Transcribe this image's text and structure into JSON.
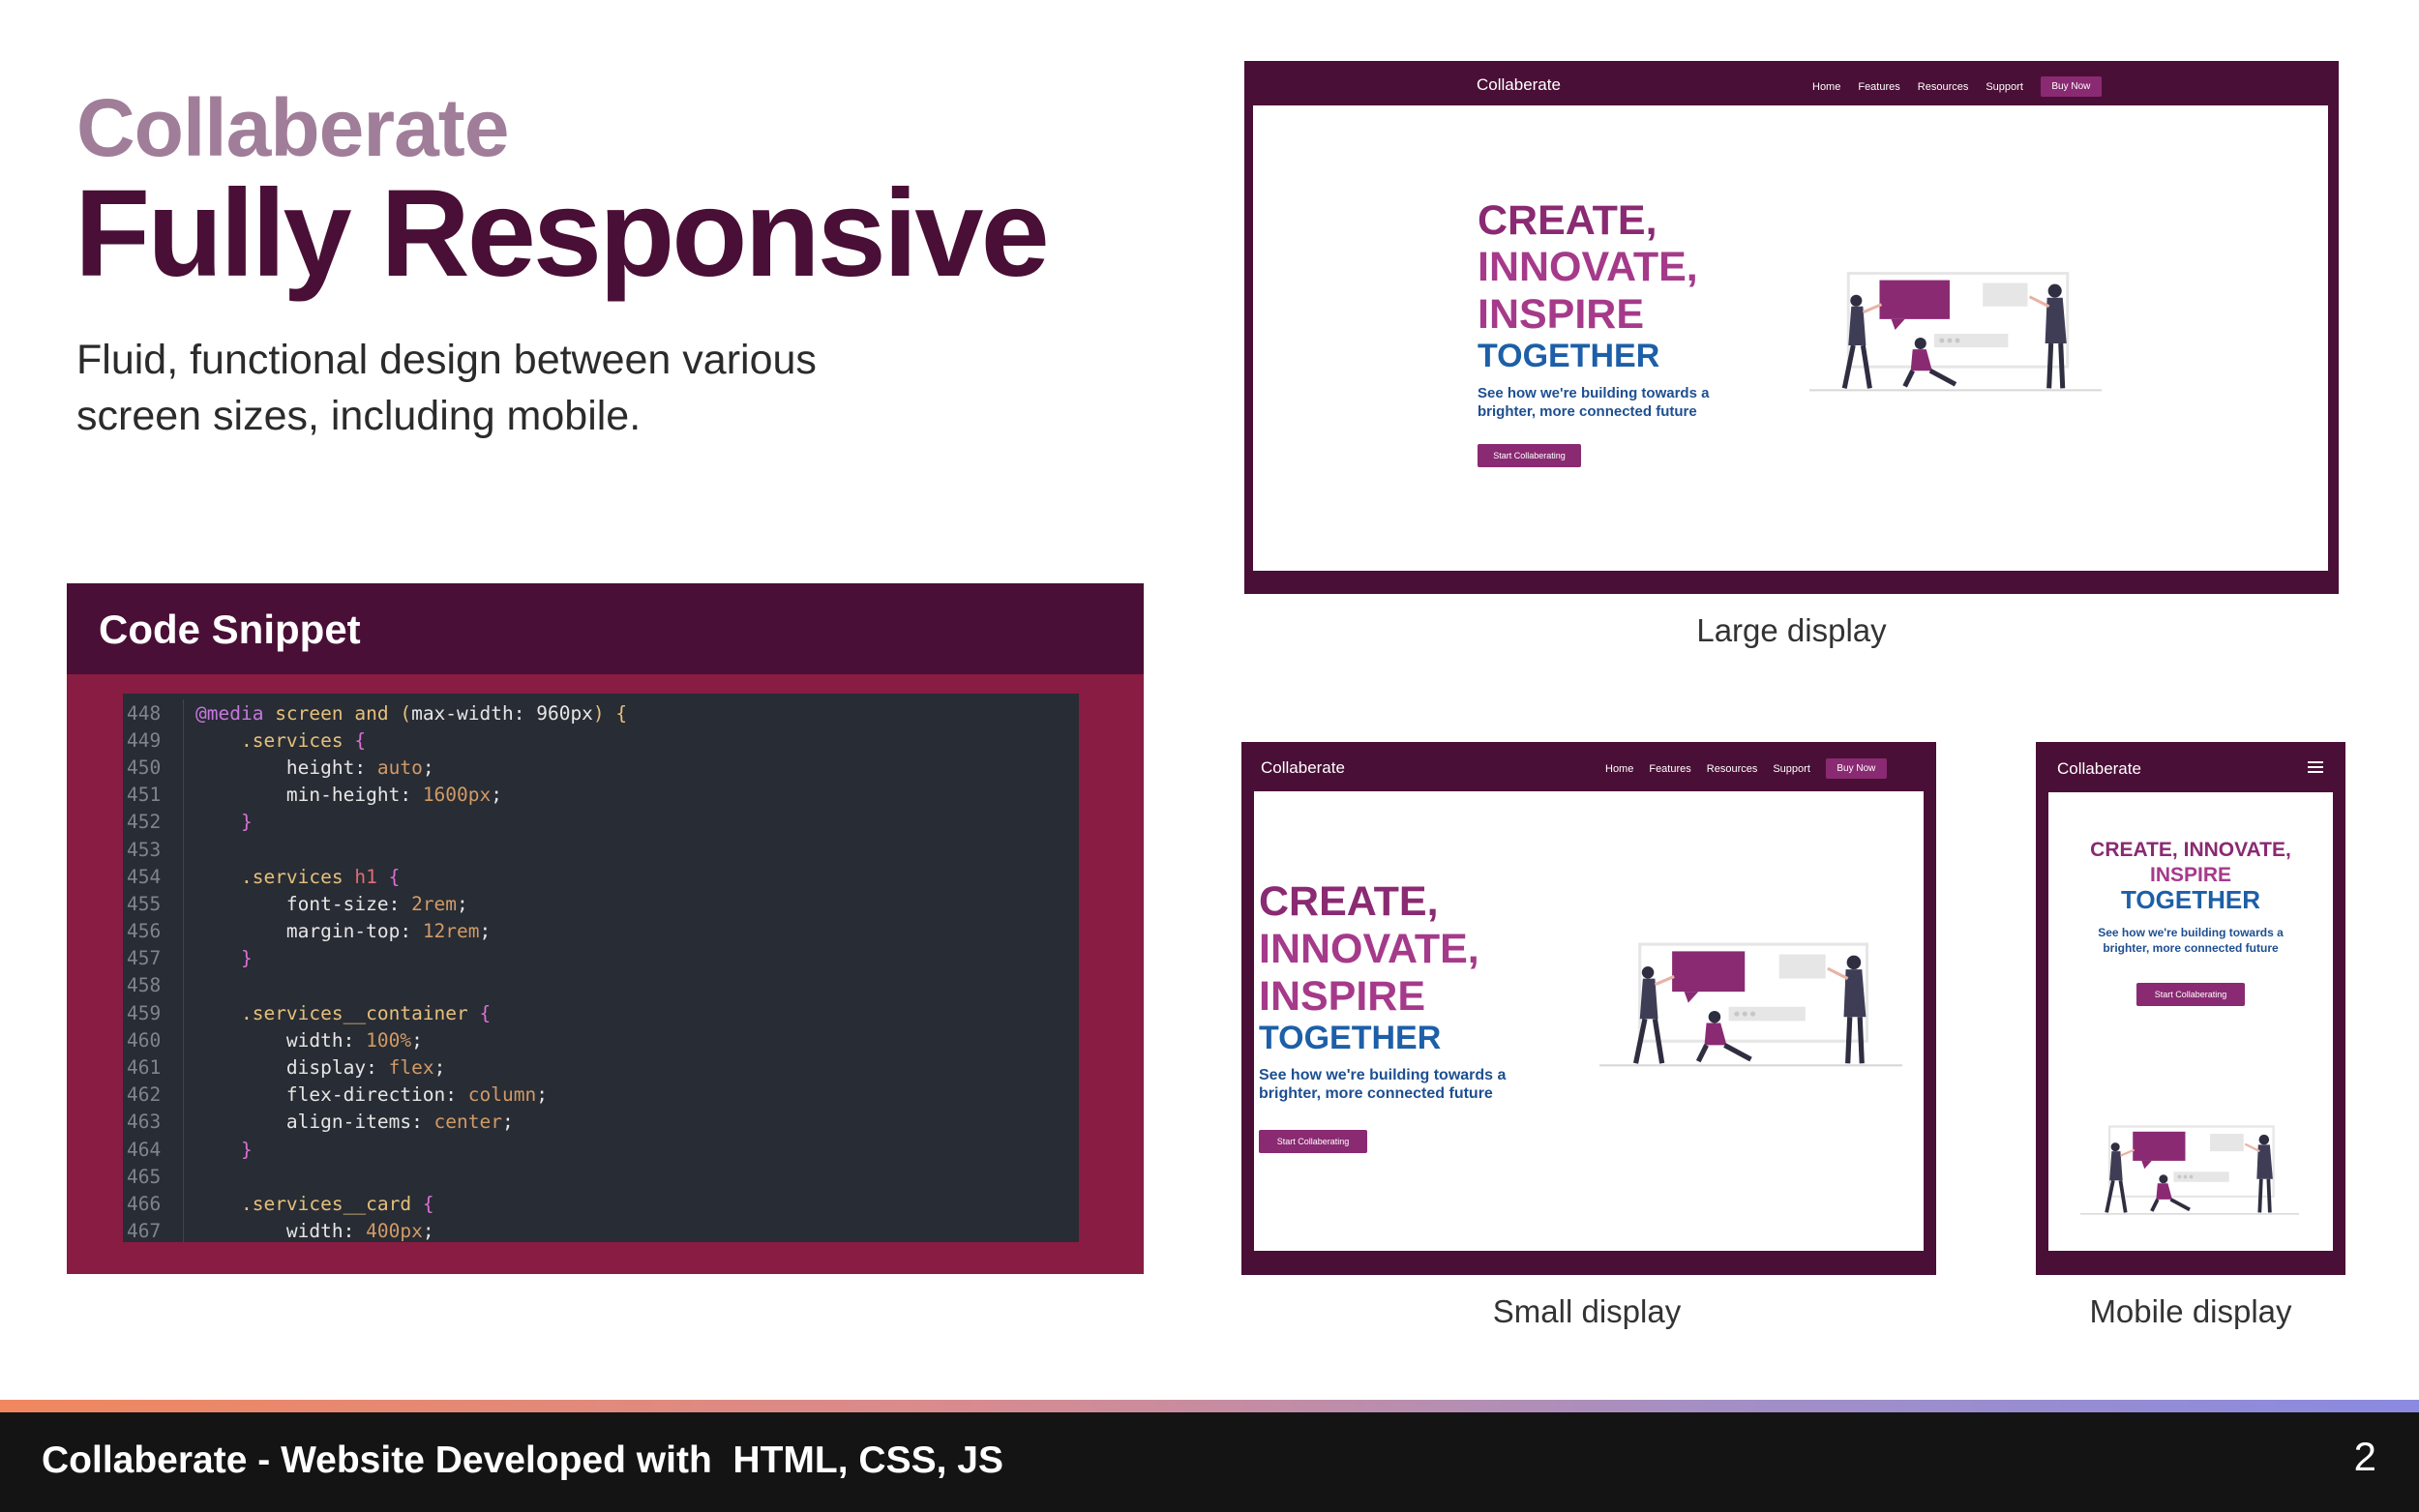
{
  "header": {
    "brand": "Collaberate",
    "headline": "Fully Responsive",
    "description": "Fluid, functional design between various screen sizes, including mobile."
  },
  "code_snippet": {
    "title": "Code Snippet",
    "lines": [
      {
        "num": "448",
        "text": "@media screen and (max-width: 960px) {"
      },
      {
        "num": "449",
        "text": "    .services {"
      },
      {
        "num": "450",
        "text": "        height: auto;"
      },
      {
        "num": "451",
        "text": "        min-height: 1600px;"
      },
      {
        "num": "452",
        "text": "    }"
      },
      {
        "num": "453",
        "text": ""
      },
      {
        "num": "454",
        "text": "    .services h1 {"
      },
      {
        "num": "455",
        "text": "        font-size: 2rem;"
      },
      {
        "num": "456",
        "text": "        margin-top: 12rem;"
      },
      {
        "num": "457",
        "text": "    }"
      },
      {
        "num": "458",
        "text": ""
      },
      {
        "num": "459",
        "text": "    .services__container {"
      },
      {
        "num": "460",
        "text": "        width: 100%;"
      },
      {
        "num": "461",
        "text": "        display: flex;"
      },
      {
        "num": "462",
        "text": "        flex-direction: column;"
      },
      {
        "num": "463",
        "text": "        align-items: center;"
      },
      {
        "num": "464",
        "text": "    }"
      },
      {
        "num": "465",
        "text": ""
      },
      {
        "num": "466",
        "text": "    .services__card {"
      },
      {
        "num": "467",
        "text": "        width: 400px;"
      }
    ]
  },
  "site": {
    "brand": "Collaberate",
    "nav": [
      "Home",
      "Features",
      "Resources",
      "Support"
    ],
    "buy_label": "Buy Now",
    "hero_create": "CREATE,",
    "hero_innovate": "INNOVATE,",
    "hero_inspire": "INSPIRE",
    "hero_create_innovate": "CREATE, INNOVATE,",
    "hero_together": "TOGETHER",
    "subtitle_line1": "See how we're building towards a",
    "subtitle_line2": "brighter, more connected future",
    "cta_label": "Start Collaberating"
  },
  "captions": {
    "large": "Large display",
    "small": "Small display",
    "mobile": "Mobile display"
  },
  "footer": {
    "title": "Collaberate - Website Developed with  HTML, CSS, JS",
    "page_number": "2"
  },
  "colors": {
    "dark_plum": "#4a0f36",
    "magenta": "#891c42",
    "brand_light": "#a07d98",
    "hero_purple": "#8a2a72",
    "hero_blue": "#1d5fa8"
  },
  "icons": [
    "hamburger-menu-icon",
    "collaboration-illustration"
  ]
}
